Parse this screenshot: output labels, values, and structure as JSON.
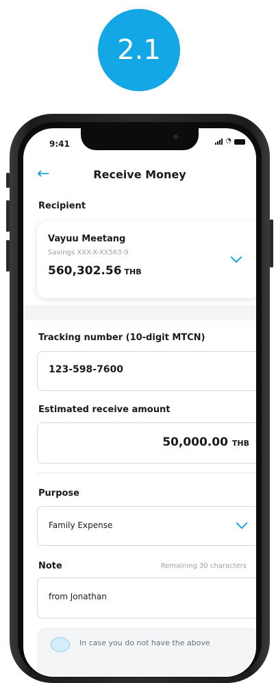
{
  "step": {
    "label": "2.1",
    "color": "#13A7E6"
  },
  "status_bar": {
    "time": "9:41"
  },
  "header": {
    "title": "Receive Money",
    "back_icon": "arrow-left-icon"
  },
  "recipient": {
    "section_label": "Recipient",
    "name": "Vayuu Meetang",
    "account": "Savings XXX-X-XX563-9",
    "balance": "560,302.56",
    "currency": "THB"
  },
  "tracking": {
    "label": "Tracking number (10-digit MTCN)",
    "value": "123-598-7600"
  },
  "amount": {
    "label": "Estimated receive amount",
    "value": "50,000.00",
    "currency": "THB"
  },
  "purpose": {
    "label": "Purpose",
    "value": "Family Expense"
  },
  "note": {
    "label": "Note",
    "remaining": "Remaining 30 characters",
    "value": "from Jonathan"
  },
  "info": {
    "text": "In case you do not have the above"
  }
}
